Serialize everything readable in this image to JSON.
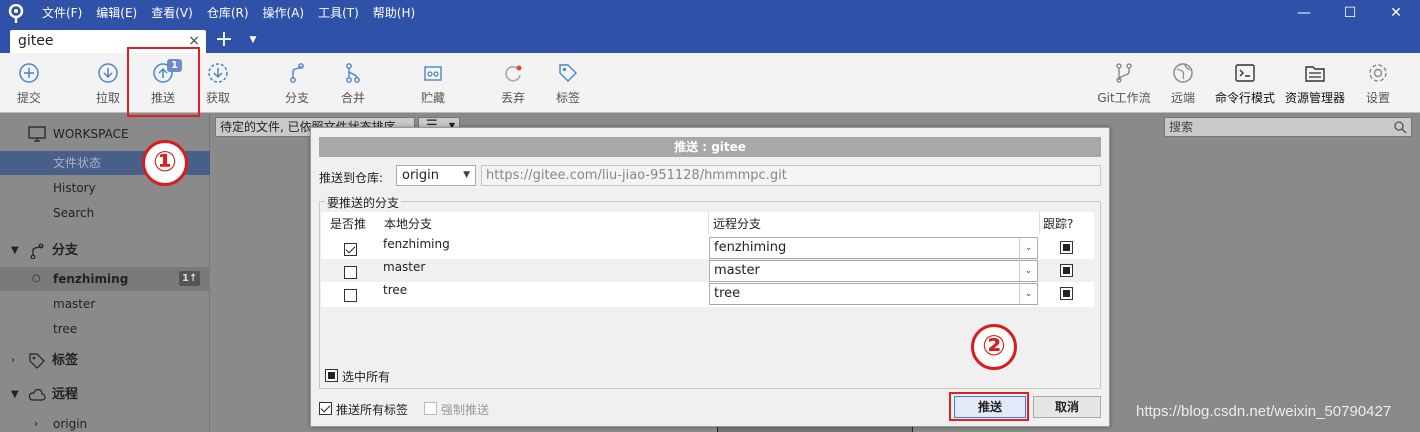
{
  "window": {
    "menu": [
      "文件(F)",
      "编辑(E)",
      "查看(V)",
      "仓库(R)",
      "操作(A)",
      "工具(T)",
      "帮助(H)"
    ],
    "minimize": "—",
    "maximize": "☐",
    "close": "✕"
  },
  "tabs": {
    "active": "gitee",
    "close": "×",
    "add": "+",
    "menu": "▼"
  },
  "toolbar": {
    "commit": "提交",
    "pull": "拉取",
    "push": "推送",
    "push_badge": "1",
    "fetch": "获取",
    "branch": "分支",
    "merge": "合并",
    "stash": "贮藏",
    "discard": "丢弃",
    "tag": "标签",
    "gitflow": "Git工作流",
    "remote": "远端",
    "terminal": "命令行模式",
    "explorer": "资源管理器",
    "settings": "设置"
  },
  "sidebar": {
    "workspace": "WORKSPACE",
    "file_status": "文件状态",
    "history": "History",
    "search": "Search",
    "branches": "分支",
    "branch_items": [
      "fenzhiming",
      "master",
      "tree"
    ],
    "current_branch_count": "1↑",
    "tags": "标签",
    "remotes": "远程",
    "remote_items": [
      "origin"
    ]
  },
  "main": {
    "filter": "待定的文件, 已依照文件状态排序",
    "search_placeholder": "搜索"
  },
  "dialog": {
    "title": "推送 : gitee",
    "push_to_label": "推送到仓库:",
    "remote": "origin",
    "remote_url": "https://gitee.com/liu-jiao-951128/hmmmpc.git",
    "group_title": "要推送的分支",
    "columns": {
      "push": "是否推",
      "local": "本地分支",
      "remote": "远程分支",
      "track": "跟踪?"
    },
    "rows": [
      {
        "local": "fenzhiming",
        "remote": "fenzhiming",
        "push": true,
        "track": true
      },
      {
        "local": "master",
        "remote": "master",
        "push": false,
        "track": true
      },
      {
        "local": "tree",
        "remote": "tree",
        "push": false,
        "track": true
      }
    ],
    "select_all": "选中所有",
    "push_all_tags": "推送所有标签",
    "force_push": "强制推送",
    "ok": "推送",
    "cancel": "取消"
  },
  "annotations": {
    "step1": "①",
    "step2": "②"
  },
  "watermark": "https://blog.csdn.net/weixin_50790427",
  "colors": {
    "titlebar": "#2f52a8",
    "highlight": "#e01f25",
    "selection": "#475f89"
  }
}
